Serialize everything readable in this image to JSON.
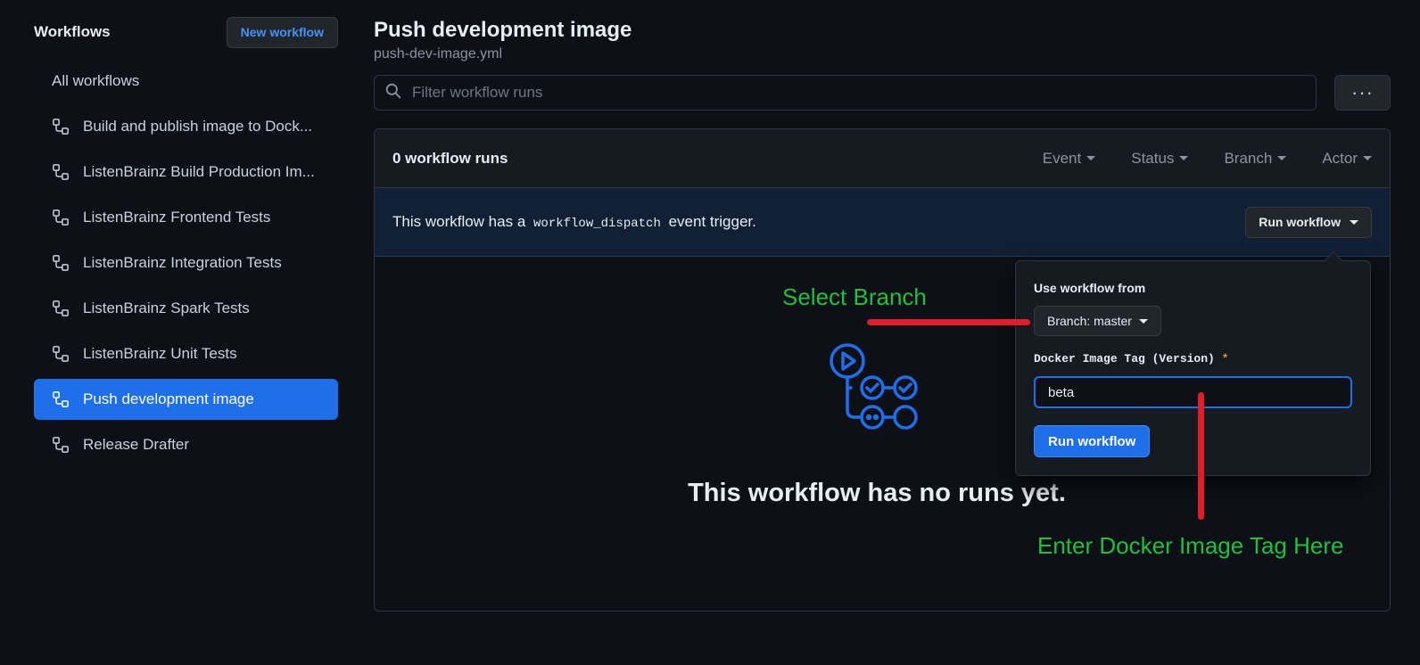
{
  "sidebar": {
    "title": "Workflows",
    "new_button": "New workflow",
    "all_label": "All workflows",
    "items": [
      {
        "label": "Build and publish image to Dock..."
      },
      {
        "label": "ListenBrainz Build Production Im..."
      },
      {
        "label": "ListenBrainz Frontend Tests"
      },
      {
        "label": "ListenBrainz Integration Tests"
      },
      {
        "label": "ListenBrainz Spark Tests"
      },
      {
        "label": "ListenBrainz Unit Tests"
      },
      {
        "label": "Push development image",
        "active": true
      },
      {
        "label": "Release Drafter"
      }
    ]
  },
  "header": {
    "title": "Push development image",
    "filename": "push-dev-image.yml"
  },
  "search": {
    "placeholder": "Filter workflow runs",
    "icon": "search-icon"
  },
  "more_button": "···",
  "runs": {
    "count_label": "0 workflow runs",
    "filters": [
      "Event",
      "Status",
      "Branch",
      "Actor"
    ]
  },
  "dispatch": {
    "text_before": "This workflow has a",
    "code": "workflow_dispatch",
    "text_after": "event trigger.",
    "run_button": "Run workflow"
  },
  "empty": {
    "message": "This workflow has no runs yet."
  },
  "popover": {
    "use_from_label": "Use workflow from",
    "branch_button": "Branch: master",
    "input_label": "Docker Image Tag (Version)",
    "required_mark": "*",
    "input_value": "beta",
    "submit_button": "Run workflow"
  },
  "annotations": {
    "select_branch": "Select Branch",
    "enter_tag": "Enter Docker Image Tag Here",
    "text_color": "#1fbf3f",
    "line_color": "#e11d2a"
  },
  "colors": {
    "background": "#0d1117",
    "accent": "#1f6feb",
    "link": "#4493f8"
  }
}
